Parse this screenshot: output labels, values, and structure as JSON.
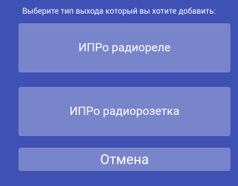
{
  "dialog": {
    "prompt": "Выберите тип выхода который вы хотите добавить:",
    "options": [
      {
        "label": "ИПРо радиореле"
      },
      {
        "label": "ИПРо радиорозетка"
      }
    ],
    "cancel_label": "Отмена"
  },
  "colors": {
    "background": "#3f51b5",
    "button": "#7985cb",
    "text": "#ffffff"
  }
}
